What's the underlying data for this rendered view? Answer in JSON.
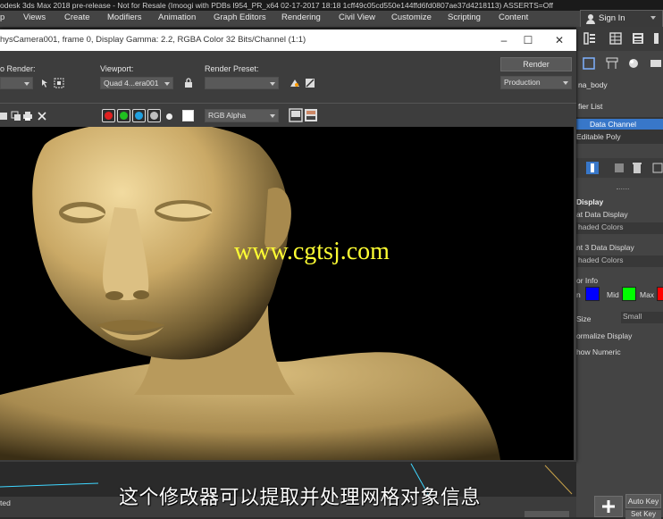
{
  "title_bar": {
    "text": "odesk 3ds Max 2018 pre-release - Not for Resale (Imoogi with PDBs I954_PR_x64 02-17-2017 18:18 1cff49c05cd550e144ffd6fd0807ae37d4218113) ASSERTS=Off"
  },
  "menu": {
    "items": [
      "p",
      "Views",
      "Create",
      "Modifiers",
      "Animation",
      "Graph Editors",
      "Rendering",
      "Civil View",
      "Customize",
      "Scripting",
      "Content"
    ],
    "sign_in": "Sign In"
  },
  "render_window": {
    "title": "hysCamera001, frame 0, Display Gamma: 2.2, RGBA Color 32 Bits/Channel (1:1)",
    "area_to_render_label": "o Render:",
    "viewport_label": "Viewport:",
    "viewport_value": "Quad 4...era001",
    "render_preset_label": "Render Preset:",
    "render_preset_value": "",
    "render_button": "Render",
    "production_value": "Production",
    "channel_value": "RGB Alpha"
  },
  "command_panel": {
    "object_name": "na_body",
    "modifier_list": "fier List",
    "stack_items": [
      {
        "label": "Data Channel",
        "selected": true
      },
      {
        "label": "Editable Poly",
        "selected": false
      }
    ],
    "display_header": "Display",
    "at_data_display": "at Data Display",
    "shaded_colors_1": "haded Colors",
    "nt3_data_display": "nt 3 Data Display",
    "shaded_colors_2": "haded Colors",
    "or_info": "or Info",
    "min_label": "n",
    "mid_label": "Mid",
    "max_label": "Max",
    "size_label": "Size",
    "size_value": "Small",
    "normalize_display": "ormalize Display",
    "show_numeric": "how Numeric",
    "colors": {
      "min": "#0000ff",
      "mid": "#00ff00",
      "max": "#ff0000"
    }
  },
  "watermark": "www.cgtsj.com",
  "subtitle": "这个修改器可以提取并处理网格对象信息",
  "status": {
    "left_text": "ted"
  },
  "bottom_right": {
    "auto_key": "Auto Key",
    "set_key": "Set Key"
  }
}
